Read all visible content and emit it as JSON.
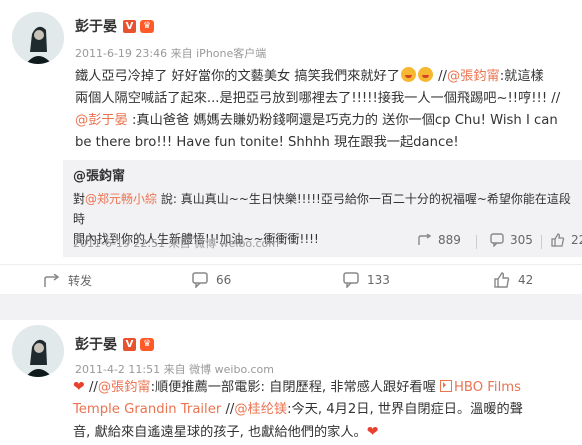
{
  "post1": {
    "author": "彭于晏",
    "meta_time": "2011-6-19 23:46",
    "meta_from": "来自",
    "meta_source": "iPhone客户端",
    "line1_a": "鐵人亞弓冷掉了 好好當你的文藝美女 搞笑我們來就好了",
    "line1_b": " //",
    "line1_at": "@張鈞甯",
    "line1_c": ":就這樣",
    "line2": "兩個人隔空喊話了起來...是把亞弓放到哪裡去了!!!!!接我一人一個飛踢吧~!!哼!!! //",
    "line3_at": "@彭于晏",
    "line3_rest": " :真山爸爸 媽媽去賺奶粉錢啊還是巧克力的 送你一個cp Chu! Wish I can",
    "line4": "be there bro!!! Have fun tonite! Shhhh 現在跟我一起dance!",
    "repost": {
      "author": "@張鈞甯",
      "text_a": "對",
      "text_at": "@郑元畅小綜",
      "text_b": " 說: 真山真山~~生日快樂!!!!!亞弓給你一百二十分的祝福喔~希望你能在這段時",
      "text_line2": "間內找到你的人生新體悟!!!加油~~衝衝衝!!!!",
      "meta_time": "2011-6-19 22:51",
      "meta_from": "来自",
      "meta_source": "微博 weibo.com",
      "reposts": "889",
      "comments": "305",
      "likes": "22"
    },
    "action_repost": "转发",
    "action_comments": "66",
    "action_reposts": "133",
    "action_likes": "42"
  },
  "post2": {
    "author": "彭于晏",
    "meta_time": "2011-4-2 11:51",
    "meta_from": "来自",
    "meta_source": "微博 weibo.com",
    "line1_a": "//",
    "line1_at": "@張鈞甯",
    "line1_b": ":順便推薦一部電影: 自閉歷程, 非常感人跟好看喔",
    "line1_link": "HBO Films",
    "line2_link": "Temple Grandin Trailer",
    "line2_a": " //",
    "line2_at": "@桂纶镁",
    "line2_b": ":今天, 4月2日, 世界自閉症日。溫暖的聲",
    "line3": "音, 獻給來自遙遠星球的孩子, 也獻給他們的家人。"
  },
  "colors": {
    "link": "#eb7350",
    "vip": "#ff5a28"
  }
}
